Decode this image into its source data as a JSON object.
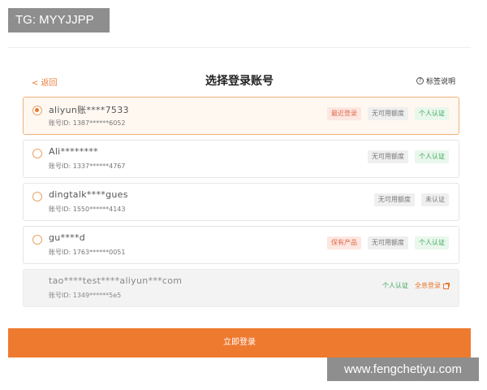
{
  "watermarks": {
    "top": "TG: MYYJJPP",
    "bottom": "www.fengchetiyu.com"
  },
  "header": {
    "back_label": "< 返回",
    "title": "选择登录账号",
    "help_icon": "question-circle-icon",
    "help_label": "标签说明"
  },
  "accounts": [
    {
      "name": "aliyun账****7533",
      "account_id": "账号ID: 1387******6052",
      "selected": true,
      "tags": [
        {
          "label": "最近登录",
          "style": "red"
        },
        {
          "label": "无可用额度",
          "style": "grey"
        },
        {
          "label": "个人认证",
          "style": "green"
        }
      ]
    },
    {
      "name": "Ali********",
      "account_id": "账号ID: 1337******4767",
      "selected": false,
      "tags": [
        {
          "label": "无可用额度",
          "style": "grey"
        },
        {
          "label": "个人认证",
          "style": "green"
        }
      ]
    },
    {
      "name": "dingtalk****gues",
      "account_id": "账号ID: 1550******4143",
      "selected": false,
      "tags": [
        {
          "label": "无可用额度",
          "style": "grey"
        },
        {
          "label": "未认证",
          "style": "grey"
        }
      ]
    },
    {
      "name": "gu****d",
      "account_id": "账号ID: 1763******0051",
      "selected": false,
      "tags": [
        {
          "label": "保有产品",
          "style": "red"
        },
        {
          "label": "无可用额度",
          "style": "grey"
        },
        {
          "label": "个人认证",
          "style": "green"
        }
      ]
    },
    {
      "name": "tao****test****aliyun***com",
      "account_id": "账号ID: 1349******5e5",
      "selected": false,
      "disabled": true,
      "tags": [
        {
          "label": "个人认证",
          "style": "green-plain"
        },
        {
          "label": "全息登录",
          "style": "link",
          "icon": "external-link-icon"
        }
      ]
    }
  ],
  "footer": {
    "login_label": "立即登录"
  },
  "colors": {
    "accent": "#ee7a30",
    "tag_red_bg": "#fde7e1",
    "tag_green": "#3aa55a"
  }
}
